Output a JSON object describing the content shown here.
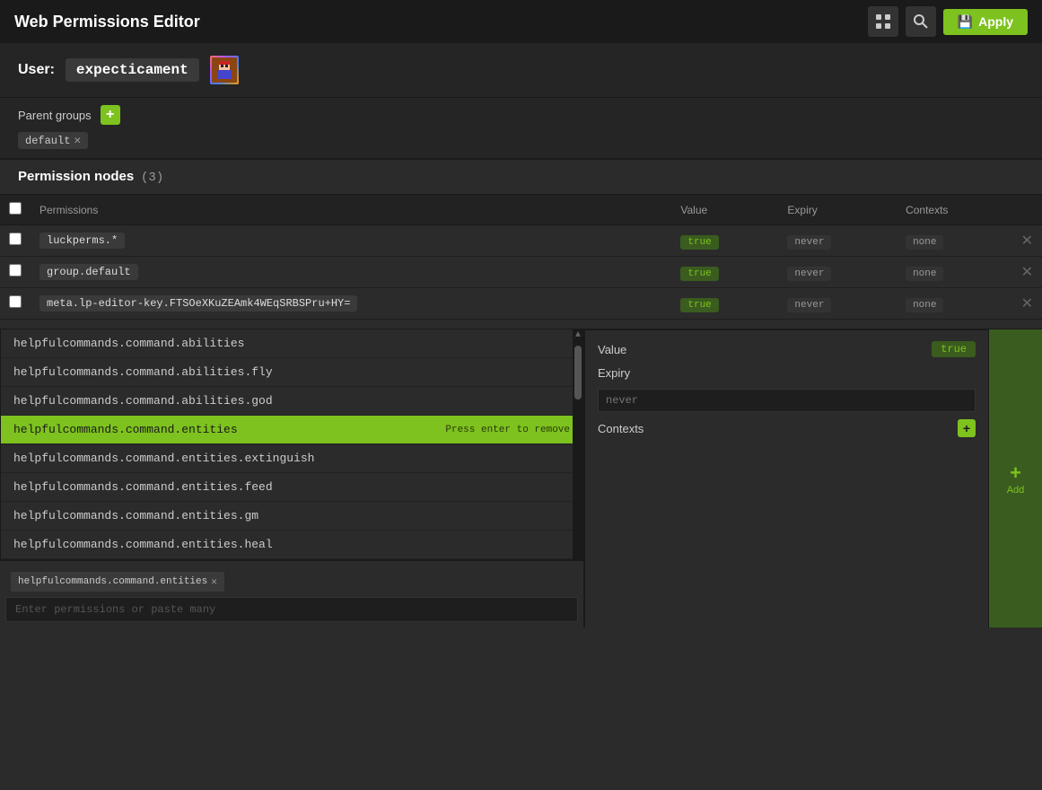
{
  "header": {
    "title": "Web Permissions Editor",
    "apply_label": "Apply"
  },
  "user": {
    "label": "User:",
    "username": "expecticament"
  },
  "parent_groups": {
    "label": "Parent groups",
    "add_label": "+",
    "groups": [
      {
        "name": "default"
      }
    ]
  },
  "permission_nodes": {
    "title": "Permission nodes",
    "count": "(3)",
    "columns": {
      "checkbox": "",
      "permissions": "Permissions",
      "value": "Value",
      "expiry": "Expiry",
      "contexts": "Contexts"
    },
    "rows": [
      {
        "permission": "luckperms.*",
        "value": "true",
        "expiry": "never",
        "contexts": "none"
      },
      {
        "permission": "group.default",
        "value": "true",
        "expiry": "never",
        "contexts": "none"
      },
      {
        "permission": "meta.lp-editor-key.FTSOeXKuZEAmk4WEqSRBSPru+HY=",
        "value": "true",
        "expiry": "never",
        "contexts": "none"
      }
    ]
  },
  "autocomplete": {
    "items": [
      {
        "label": "helpfulcommands.command.abilities",
        "active": false
      },
      {
        "label": "helpfulcommands.command.abilities.fly",
        "active": false
      },
      {
        "label": "helpfulcommands.command.abilities.god",
        "active": false
      },
      {
        "label": "helpfulcommands.command.entities",
        "active": true,
        "hint": "Press enter to remove"
      },
      {
        "label": "helpfulcommands.command.entities.extinguish",
        "active": false
      },
      {
        "label": "helpfulcommands.command.entities.feed",
        "active": false
      },
      {
        "label": "helpfulcommands.command.entities.gm",
        "active": false
      },
      {
        "label": "helpfulcommands.command.entities.heal",
        "active": false
      }
    ]
  },
  "new_permission": {
    "selected_perm": "helpfulcommands.command.entities",
    "input_placeholder": "Enter permissions or paste many"
  },
  "add_form": {
    "value_label": "Value",
    "value_badge": "true",
    "expiry_label": "Expiry",
    "expiry_placeholder": "never",
    "contexts_label": "Contexts",
    "add_context_btn": "+",
    "add_label": "Add",
    "add_plus": "+"
  }
}
